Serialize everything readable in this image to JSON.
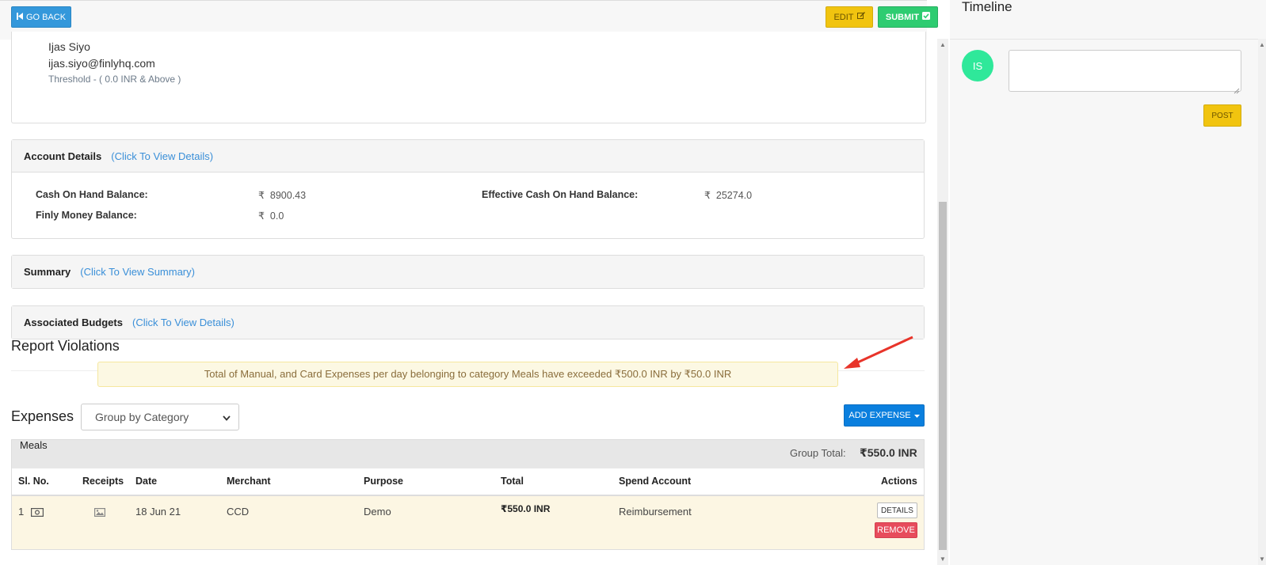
{
  "header": {
    "go_back_label": "GO BACK",
    "edit_label": "EDIT",
    "submit_label": "SUBMIT"
  },
  "approver": {
    "name": "Ijas Siyo",
    "email": "ijas.siyo@finlyhq.com",
    "threshold": "Threshold -  ( 0.0 INR & Above )"
  },
  "account_details": {
    "title": "Account Details",
    "link": "(Click To View Details)",
    "currency_symbol": "₹",
    "cash_on_hand_label": "Cash On Hand Balance:",
    "cash_on_hand_value": "8900.43",
    "effective_cash_label": "Effective Cash On Hand Balance:",
    "effective_cash_value": "25274.0",
    "finly_money_label": "Finly Money Balance:",
    "finly_money_value": "0.0"
  },
  "summary": {
    "title": "Summary",
    "link": "(Click To View Summary)"
  },
  "budgets": {
    "title": "Associated Budgets",
    "link": "(Click To View Details)"
  },
  "violations": {
    "title": "Report Violations",
    "message": "Total of Manual, and Card Expenses per day belonging to category Meals have exceeded ₹500.0 INR by ₹50.0 INR"
  },
  "expenses": {
    "title": "Expenses",
    "group_by_selected": "Group by Category",
    "add_expense_label": "ADD EXPENSE",
    "group": {
      "name": "Meals",
      "total_label": "Group Total:",
      "total_value": "₹550.0 INR"
    },
    "columns": [
      "Sl. No.",
      "Receipts",
      "Date",
      "Merchant",
      "Purpose",
      "Total",
      "Spend Account",
      "Actions"
    ],
    "rows": [
      {
        "sl_no": "1",
        "date": "18 Jun 21",
        "merchant": "CCD",
        "purpose": "Demo",
        "total": "₹550.0 INR",
        "spend_account": "Reimbursement",
        "details_label": "DETAILS",
        "remove_label": "REMOVE"
      }
    ]
  },
  "timeline": {
    "title": "Timeline",
    "avatar_initials": "IS",
    "post_label": "POST"
  },
  "colors": {
    "primary_blue": "#3498db",
    "edit_yellow": "#f1c40f",
    "submit_green": "#2ecc71",
    "remove_red": "#e74c5c",
    "avatar_green": "#2fe89a",
    "warning_bg": "#fcf8e3"
  }
}
